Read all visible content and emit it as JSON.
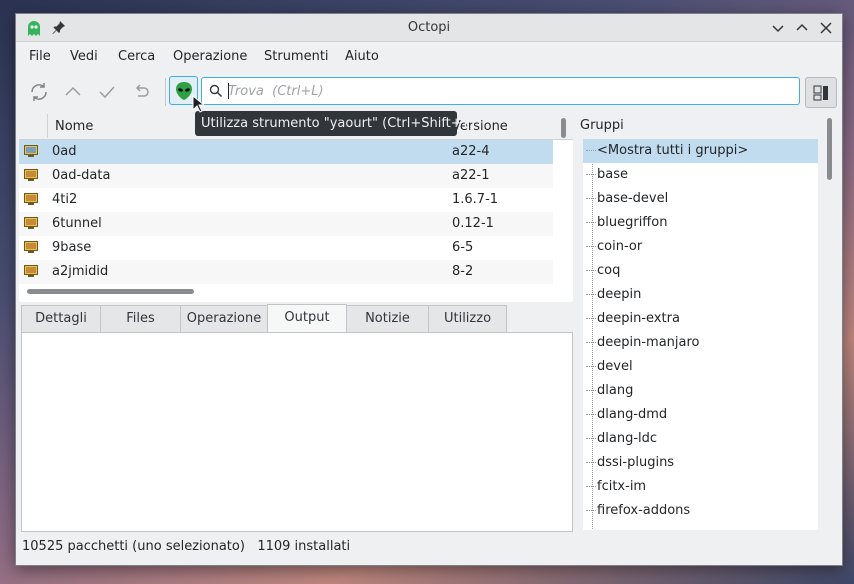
{
  "window": {
    "title": "Octopi"
  },
  "menubar": {
    "items": [
      "File",
      "Vedi",
      "Cerca",
      "Operazione",
      "Strumenti",
      "Aiuto"
    ]
  },
  "search": {
    "placeholder": "Trova  (Ctrl+L)",
    "value": ""
  },
  "tooltip": {
    "text": "Utilizza strumento \"yaourt\"  (Ctrl+Shift+Y)"
  },
  "packages": {
    "columns": {
      "name": "Nome",
      "version": "Versione"
    },
    "rows": [
      {
        "name": "0ad",
        "version": "a22-4"
      },
      {
        "name": "0ad-data",
        "version": "a22-1"
      },
      {
        "name": "4ti2",
        "version": "1.6.7-1"
      },
      {
        "name": "6tunnel",
        "version": "0.12-1"
      },
      {
        "name": "9base",
        "version": "6-5"
      },
      {
        "name": "a2jmidid",
        "version": "8-2"
      }
    ]
  },
  "tabs": [
    "Dettagli",
    "Files",
    "Operazione",
    "Output",
    "Notizie",
    "Utilizzo"
  ],
  "groups": {
    "header": "Gruppi",
    "items": [
      "<Mostra tutti i gruppi>",
      "base",
      "base-devel",
      "bluegriffon",
      "coin-or",
      "coq",
      "deepin",
      "deepin-extra",
      "deepin-manjaro",
      "devel",
      "dlang",
      "dlang-dmd",
      "dlang-ldc",
      "dssi-plugins",
      "fcitx-im",
      "firefox-addons"
    ]
  },
  "status": {
    "packages": "10525 pacchetti (uno selezionato)",
    "installed": "1109 installati"
  },
  "colors": {
    "accent": "#3daee9",
    "selection": "#c1dcef",
    "alien": "#2ea043"
  }
}
